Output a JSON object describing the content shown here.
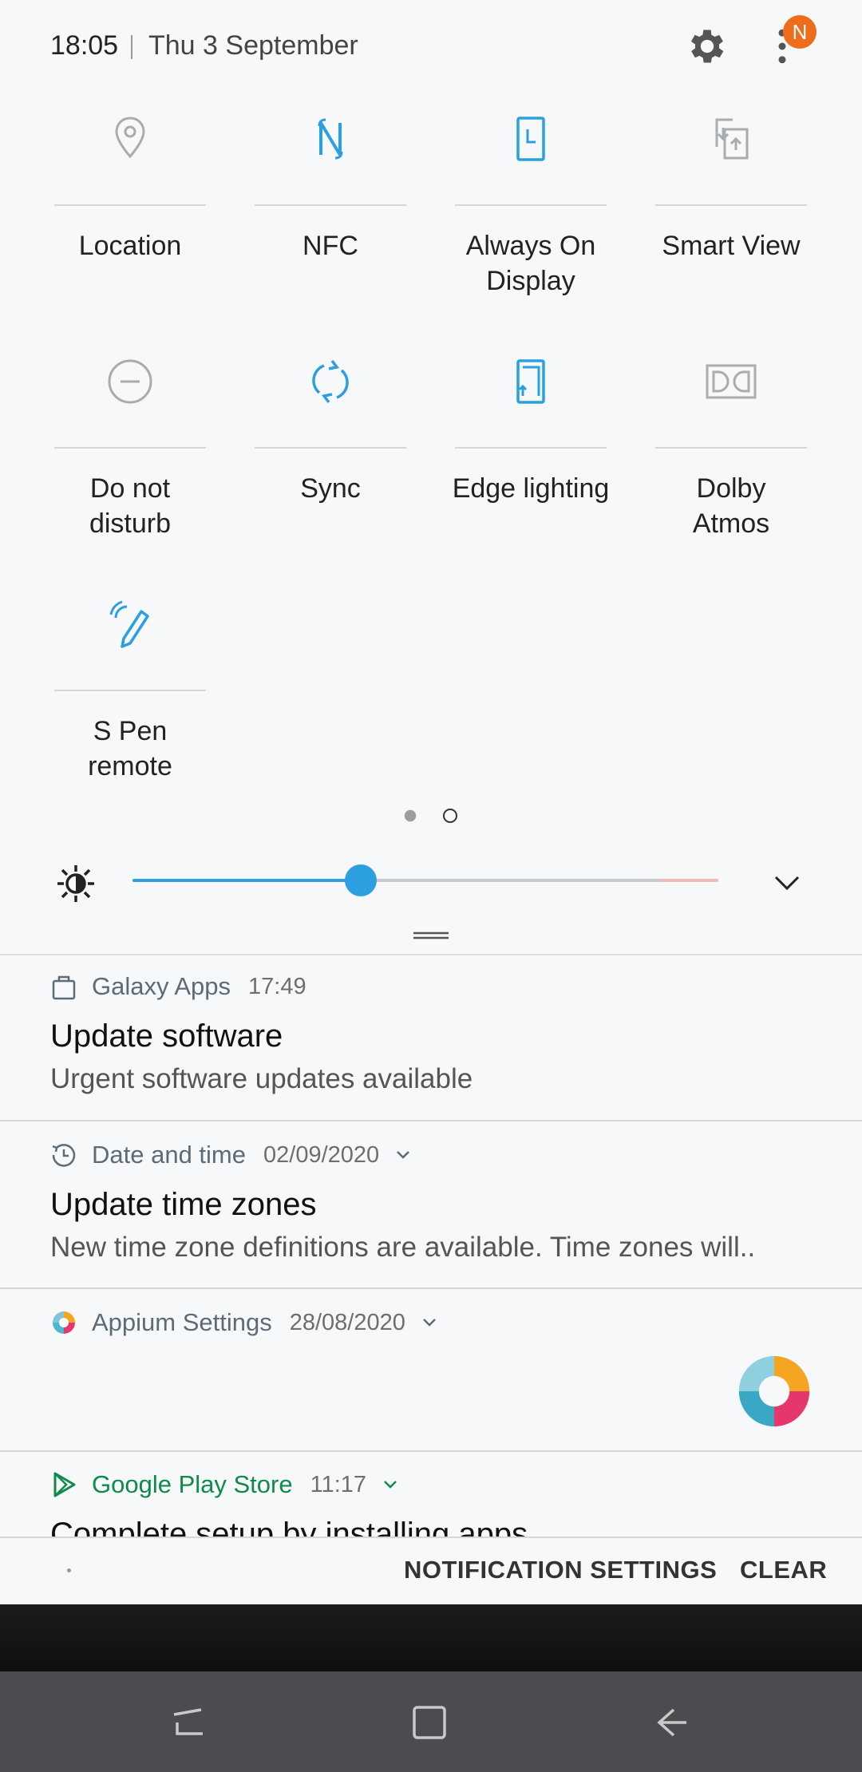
{
  "status": {
    "time": "18:05",
    "date": "Thu 3 September",
    "badge": "N",
    "settings_icon": "gear-icon",
    "more_icon": "more-vertical-icon"
  },
  "tiles": [
    {
      "label_line1": "Location",
      "label_line2": "",
      "icon": "location-icon",
      "active": false
    },
    {
      "label_line1": "NFC",
      "label_line2": "",
      "icon": "nfc-icon",
      "active": true
    },
    {
      "label_line1": "Always On",
      "label_line2": "Display",
      "icon": "always-on-display-icon",
      "active": true
    },
    {
      "label_line1": "Smart View",
      "label_line2": "",
      "icon": "smart-view-icon",
      "active": false
    },
    {
      "label_line1": "Do not",
      "label_line2": "disturb",
      "icon": "do-not-disturb-icon",
      "active": false
    },
    {
      "label_line1": "Sync",
      "label_line2": "",
      "icon": "sync-icon",
      "active": true
    },
    {
      "label_line1": "Edge lighting",
      "label_line2": "",
      "icon": "edge-lighting-icon",
      "active": true
    },
    {
      "label_line1": "Dolby",
      "label_line2": "Atmos",
      "icon": "dolby-atmos-icon",
      "active": false
    },
    {
      "label_line1": "S Pen",
      "label_line2": "remote",
      "icon": "s-pen-remote-icon",
      "active": true
    }
  ],
  "pager": {
    "page": 1,
    "total": 2
  },
  "brightness": {
    "level": 0.39
  },
  "notifications": [
    {
      "app": "Galaxy Apps",
      "time": "17:49",
      "title": "Update software",
      "body": "Urgent software updates available",
      "icon": "galaxy-apps-icon"
    },
    {
      "app": "Date and time",
      "time": "02/09/2020",
      "title": "Update time zones",
      "body": "New time zone definitions are available. Time zones will..",
      "icon": "clock-icon"
    },
    {
      "app": "Appium Settings",
      "time": "28/08/2020",
      "title": "",
      "body": "",
      "icon": "appium-icon"
    },
    {
      "app": "Google Play Store",
      "time": "11:17",
      "title": "Complete setup by installing apps",
      "body": "",
      "icon": "play-store-icon"
    }
  ],
  "actions": {
    "notification_settings": "NOTIFICATION SETTINGS",
    "clear": "CLEAR"
  },
  "colors": {
    "accent": "#2b9fe0",
    "inactive_icon": "#a9acaf",
    "play_green": "#0f8a4a",
    "badge": "#ef6c1a"
  }
}
